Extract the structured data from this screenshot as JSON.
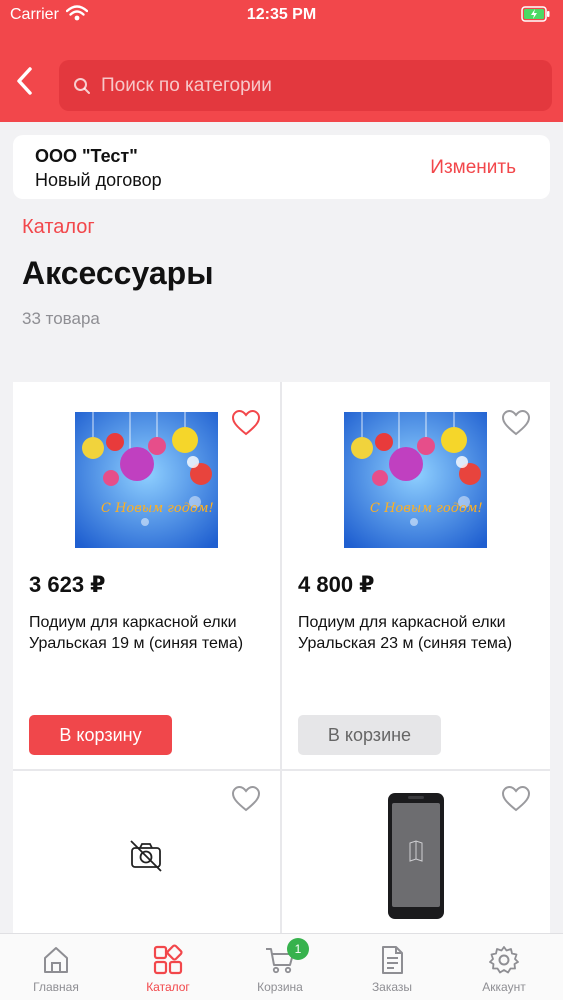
{
  "status_bar": {
    "carrier": "Carrier",
    "time": "12:35 PM"
  },
  "search": {
    "placeholder": "Поиск по категории"
  },
  "contract": {
    "org": "ООО \"Тест\"",
    "subtitle": "Новый договор",
    "change_label": "Изменить"
  },
  "breadcrumb": "Каталог",
  "title": "Аксессуары",
  "count": "33 товара",
  "products": [
    {
      "price": "3 623 ₽",
      "name": "Подиум для каркасной елки Уральская 19 м (синяя тема)",
      "button": "В корзину",
      "image": "christmas-ornaments",
      "image_caption": "С Новым годом!"
    },
    {
      "price": "4 800 ₽",
      "name": "Подиум для каркасной елки Уральская 23 м (синяя тема)",
      "button": "В корзине",
      "image": "christmas-ornaments",
      "image_caption": "С Новым годом!"
    },
    {
      "image": "no-photo-icon"
    },
    {
      "image": "smartphone"
    }
  ],
  "tabs": [
    {
      "label": "Главная",
      "icon": "home-icon"
    },
    {
      "label": "Каталог",
      "icon": "catalog-icon",
      "active": true
    },
    {
      "label": "Корзина",
      "icon": "cart-icon",
      "badge": "1"
    },
    {
      "label": "Заказы",
      "icon": "orders-icon"
    },
    {
      "label": "Аккаунт",
      "icon": "gear-icon"
    }
  ],
  "colors": {
    "accent": "#f2474b",
    "badge": "#37b24d"
  }
}
